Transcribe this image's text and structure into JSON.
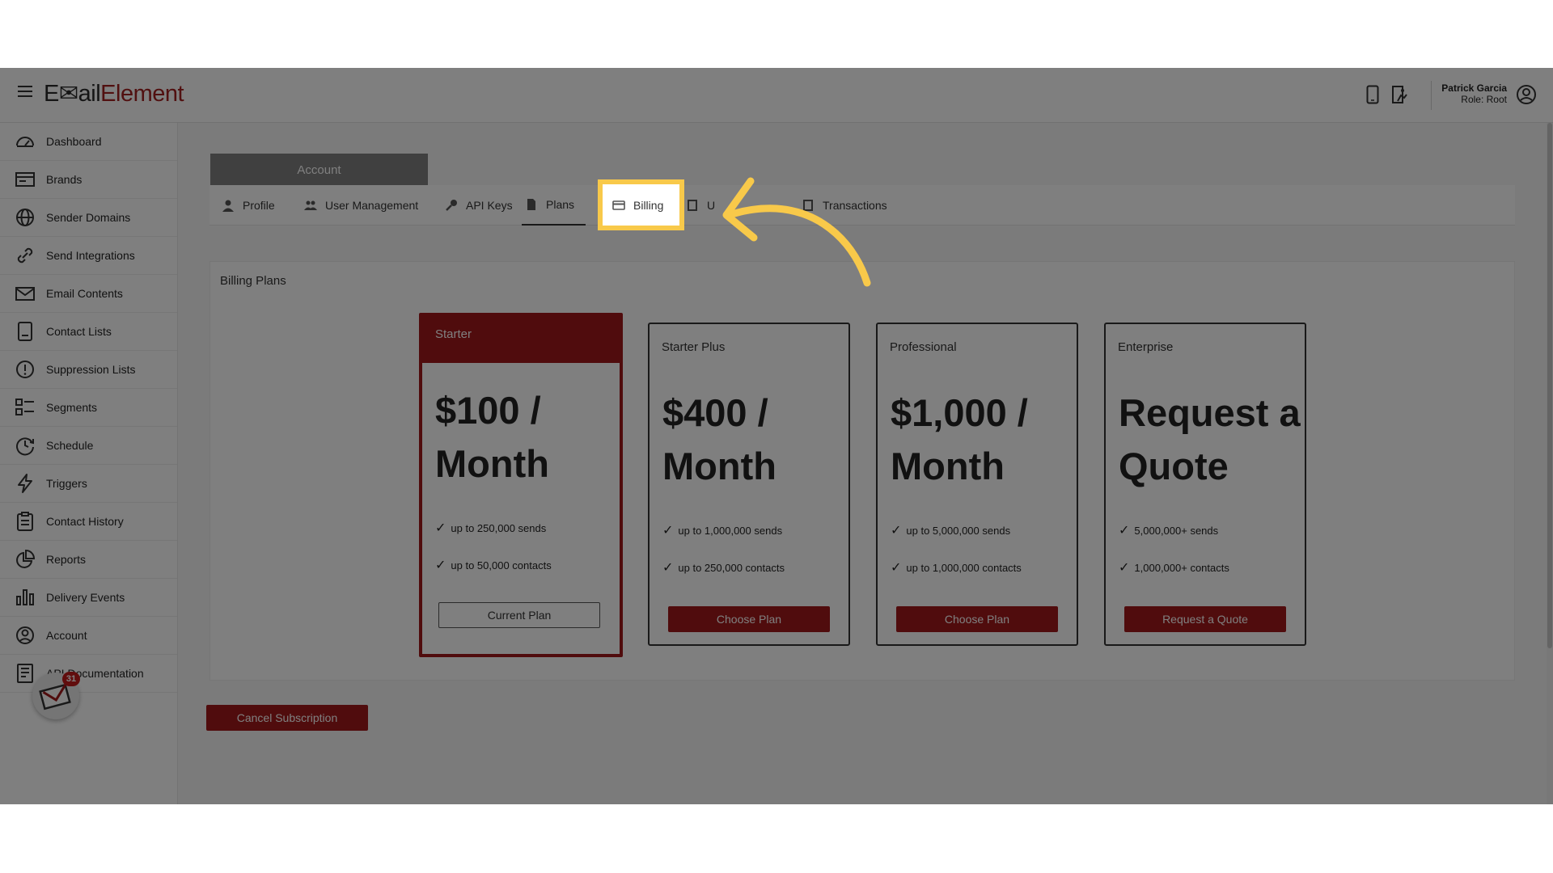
{
  "app": {
    "logo_prefix": "E",
    "logo_mid": "✉ail",
    "logo_brand": "Element",
    "brand_color": "#a32020"
  },
  "user": {
    "name": "Patrick Garcia",
    "role": "Role: Root"
  },
  "sidebar": {
    "items": [
      {
        "label": "Dashboard",
        "icon": "gauge-icon"
      },
      {
        "label": "Brands",
        "icon": "brands-icon"
      },
      {
        "label": "Sender Domains",
        "icon": "globe-icon"
      },
      {
        "label": "Send Integrations",
        "icon": "link-icon"
      },
      {
        "label": "Email Contents",
        "icon": "envelope-icon"
      },
      {
        "label": "Contact Lists",
        "icon": "list-icon"
      },
      {
        "label": "Suppression Lists",
        "icon": "alert-icon"
      },
      {
        "label": "Segments",
        "icon": "segments-icon"
      },
      {
        "label": "Schedule",
        "icon": "clock-icon"
      },
      {
        "label": "Triggers",
        "icon": "lightning-icon"
      },
      {
        "label": "Contact History",
        "icon": "clipboard-icon"
      },
      {
        "label": "Reports",
        "icon": "pie-icon"
      },
      {
        "label": "Delivery Events",
        "icon": "bar-chart-icon"
      },
      {
        "label": "Account",
        "icon": "user-circle-icon"
      },
      {
        "label": "API Documentation",
        "icon": "document-icon"
      }
    ],
    "notification_count": "31"
  },
  "account": {
    "header": "Account",
    "tabs": [
      {
        "label": "Profile",
        "icon": "person-icon"
      },
      {
        "label": "User Management",
        "icon": "users-icon"
      },
      {
        "label": "API Keys",
        "icon": "key-icon"
      },
      {
        "label": "Plans",
        "icon": "file-icon"
      },
      {
        "label": "Billing",
        "icon": "credit-card-icon"
      },
      {
        "label": "U",
        "icon": "receipt-icon"
      },
      {
        "label": "Transactions",
        "icon": "ledger-icon"
      }
    ]
  },
  "billing": {
    "title": "Billing Plans",
    "plans": [
      {
        "name": "Starter",
        "price_line1": "$100 /",
        "price_line2": "Month",
        "features": [
          "up to 250,000 sends",
          "up to 50,000 contacts"
        ],
        "button": "Current Plan",
        "current": true
      },
      {
        "name": "Starter Plus",
        "price_line1": "$400 /",
        "price_line2": "Month",
        "features": [
          "up to 1,000,000 sends",
          "up to 250,000 contacts"
        ],
        "button": "Choose Plan",
        "current": false
      },
      {
        "name": "Professional",
        "price_line1": "$1,000 /",
        "price_line2": "Month",
        "features": [
          "up to 5,000,000 sends",
          "up to 1,000,000 contacts"
        ],
        "button": "Choose Plan",
        "current": false
      },
      {
        "name": "Enterprise",
        "price_line1": "Request a",
        "price_line2": "Quote",
        "features": [
          "5,000,000+ sends",
          "1,000,000+ contacts"
        ],
        "button": "Request a Quote",
        "current": false
      }
    ],
    "cancel_label": "Cancel Subscription",
    "check_glyph": "✓"
  },
  "annotation": {
    "highlight_color": "#f8c94a"
  }
}
